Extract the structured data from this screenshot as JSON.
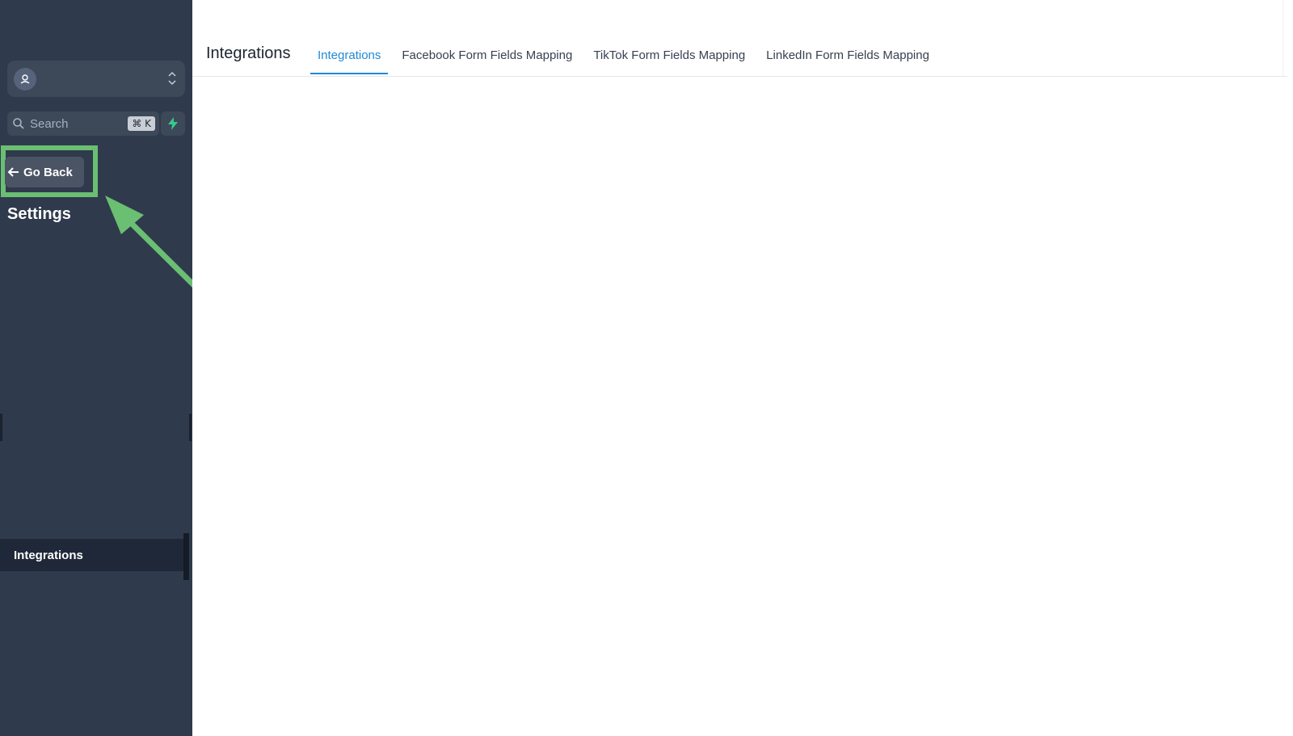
{
  "sidebar": {
    "search": {
      "placeholder": "Search",
      "shortcut": "⌘ K"
    },
    "go_back_label": "Go Back",
    "section_title": "Settings",
    "nav_items": [
      {
        "label": "Integrations",
        "active": true
      }
    ]
  },
  "header": {
    "title": "Integrations",
    "tabs": [
      {
        "label": "Integrations",
        "active": true
      },
      {
        "label": "Facebook Form Fields Mapping",
        "active": false
      },
      {
        "label": "TikTok Form Fields Mapping",
        "active": false
      },
      {
        "label": "LinkedIn Form Fields Mapping",
        "active": false
      }
    ]
  },
  "icons": {
    "account": "user-location-icon",
    "switcher": "chevron-up-down-icon",
    "search": "search-icon",
    "quick_action": "lightning-bolt-icon",
    "back": "arrow-left-icon"
  },
  "colors": {
    "sidebar_bg": "#2f3a4c",
    "accent": "#1f8ad6",
    "highlight": "#6abf72",
    "bolt": "#37c98b"
  }
}
